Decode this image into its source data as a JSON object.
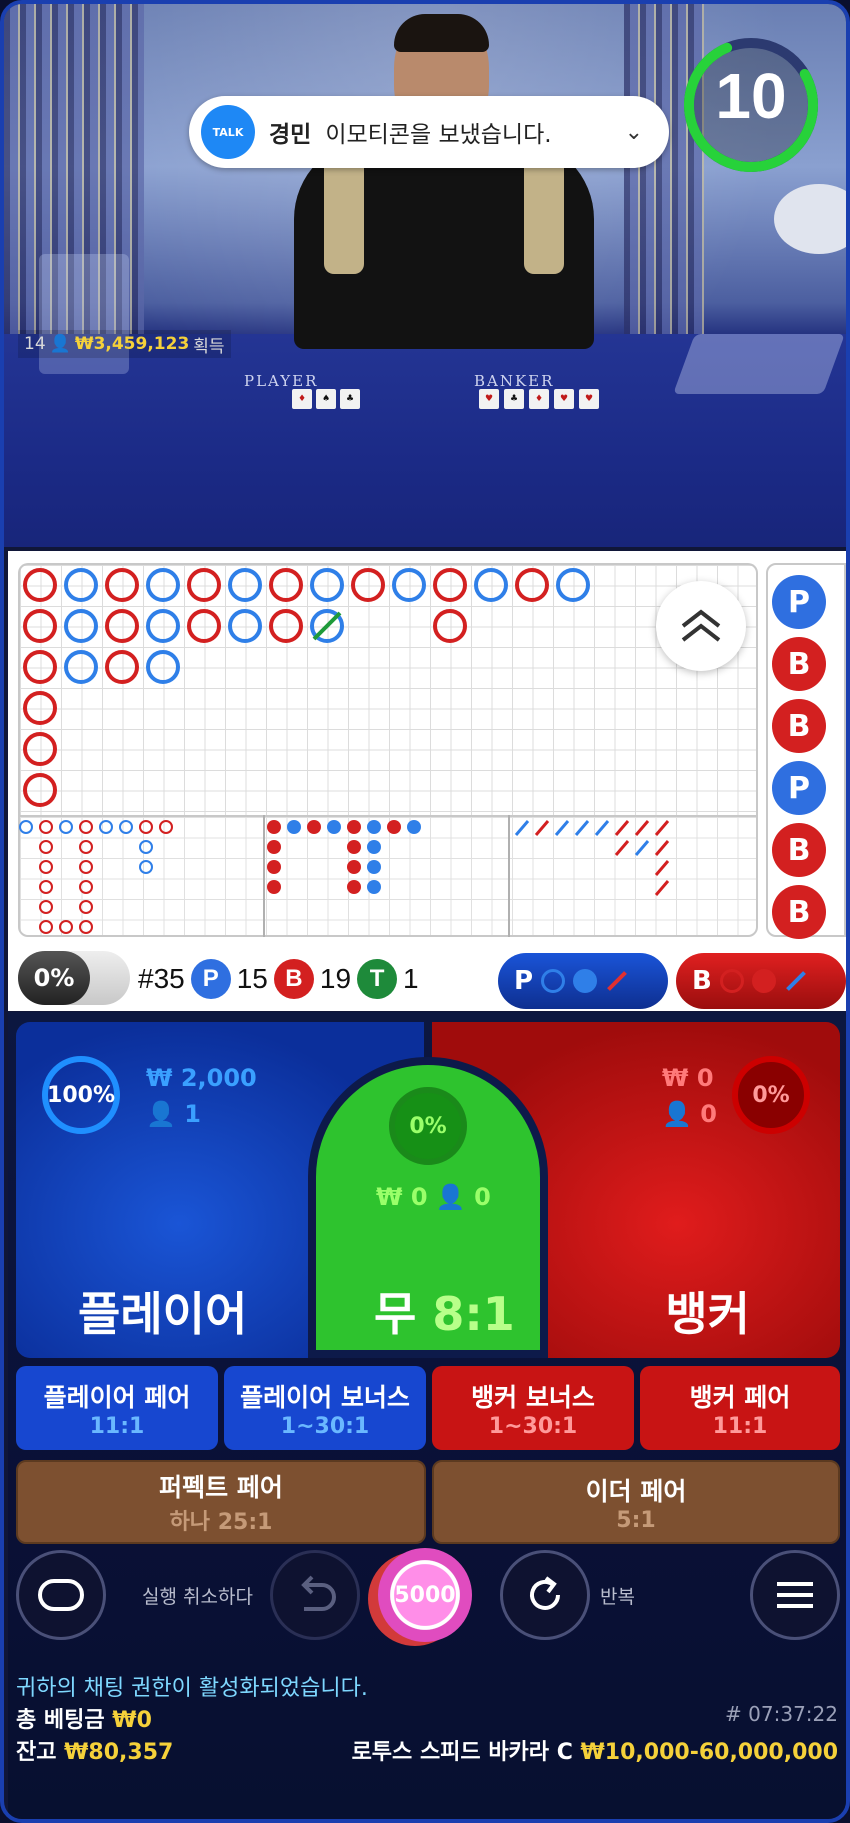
{
  "video": {
    "felt_player": "PLAYER",
    "felt_banker": "BANKER",
    "winner_count": "14",
    "winner_amount": "₩3,459,123",
    "winner_suffix": "획득",
    "timer": "10"
  },
  "notification": {
    "app_icon_text": "TALK",
    "sender": "경민",
    "message": "이모티콘을 보냈습니다."
  },
  "stats": {
    "percent": "0%",
    "shoe": "#35",
    "p_letter": "P",
    "p_count": "15",
    "b_letter": "B",
    "b_count": "19",
    "t_letter": "T",
    "t_count": "1",
    "pred_p": "P",
    "pred_b": "B"
  },
  "bead_column": [
    "P",
    "B",
    "B",
    "P",
    "B",
    "B"
  ],
  "player": {
    "percent": "100%",
    "amount": "₩ 2,000",
    "players": "1",
    "label": "플레이어"
  },
  "tie": {
    "percent": "0%",
    "amount": "₩ 0",
    "players": "0",
    "label": "무",
    "odds": "8:1"
  },
  "banker": {
    "percent": "0%",
    "amount": "₩ 0",
    "players": "0",
    "label": "뱅커"
  },
  "side_bets": [
    {
      "title": "플레이어 페어",
      "odds": "11:1"
    },
    {
      "title": "플레이어 보너스",
      "odds": "1~30:1"
    },
    {
      "title": "뱅커 보너스",
      "odds": "1~30:1"
    },
    {
      "title": "뱅커 페어",
      "odds": "11:1"
    }
  ],
  "brown_bets": [
    {
      "title": "퍼펙트 페어",
      "odds": "하나 25:1"
    },
    {
      "title": "이더 페어",
      "odds": "5:1"
    }
  ],
  "controls": {
    "undo_label": "실행 취소하다",
    "chip_value": "5000",
    "repeat_label": "반복"
  },
  "footer": {
    "chat_status": "귀하의 채팅 권한이 활성화되었습니다.",
    "total_bet_label": "총 베팅금",
    "total_bet_value": "₩0",
    "round_time": "# 07:37:22",
    "balance_label": "잔고",
    "balance_value": "₩80,357",
    "table_name": "로투스 스피드 바카라 C",
    "table_limits": "₩10,000-60,000,000"
  },
  "colors": {
    "player_blue": "#2f6fe0",
    "banker_red": "#d32020",
    "tie_green": "#2ec32e",
    "gold": "#f5d13a"
  }
}
